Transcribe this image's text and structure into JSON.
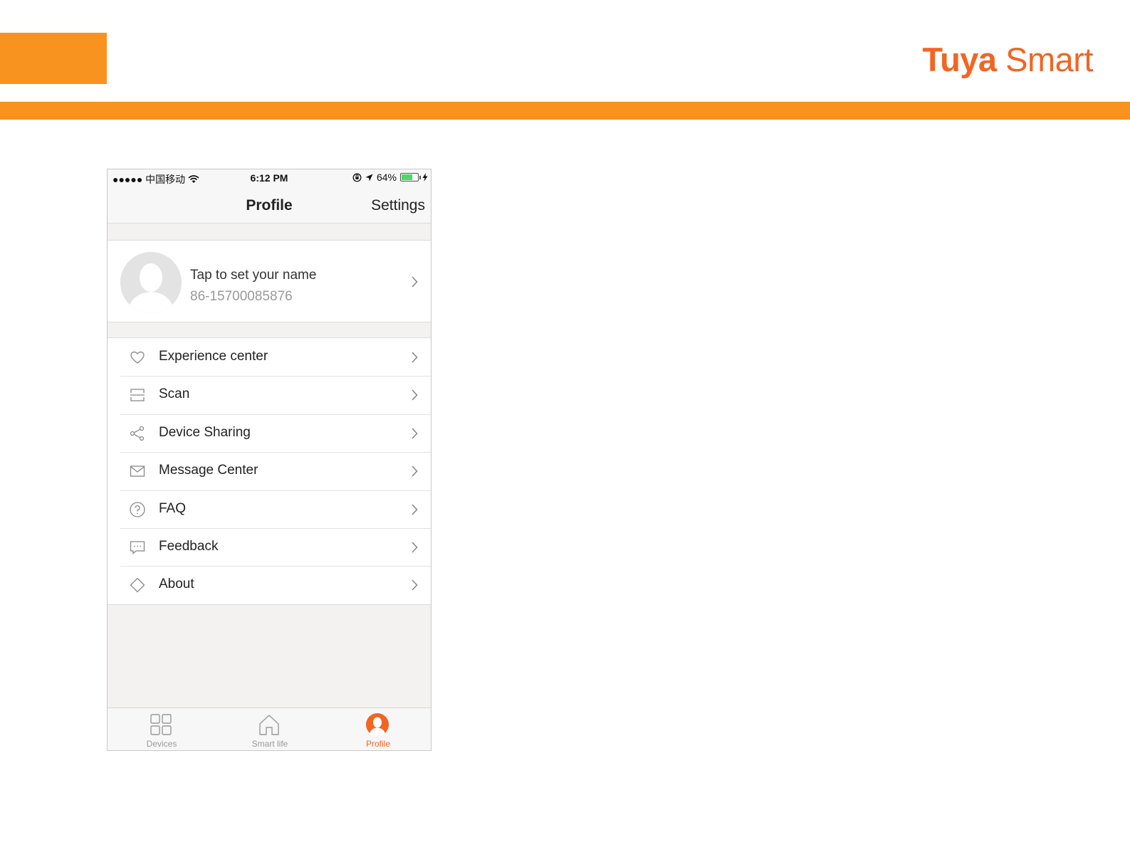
{
  "slide": {
    "brand_primary": "Tuya",
    "brand_secondary": " Smart",
    "accent_color": "#f7931e",
    "brand_color": "#f26522"
  },
  "statusbar": {
    "carrier": "●●●●● 中国移动",
    "time": "6:12 PM",
    "battery": "64%"
  },
  "navbar": {
    "title": "Profile",
    "settings_label": "Settings"
  },
  "profile": {
    "name_prompt": "Tap to set your name",
    "phone": "86-15700085876"
  },
  "menu": {
    "items": [
      {
        "label": "Experience center",
        "icon": "heart-icon"
      },
      {
        "label": "Scan",
        "icon": "scan-icon"
      },
      {
        "label": "Device Sharing",
        "icon": "share-icon"
      },
      {
        "label": "Message Center",
        "icon": "envelope-icon"
      },
      {
        "label": "FAQ",
        "icon": "question-icon"
      },
      {
        "label": "Feedback",
        "icon": "chat-icon"
      },
      {
        "label": "About",
        "icon": "diamond-icon"
      }
    ]
  },
  "tabbar": {
    "tabs": [
      {
        "label": "Devices",
        "icon": "grid-icon",
        "active": false
      },
      {
        "label": "Smart life",
        "icon": "home-icon",
        "active": false
      },
      {
        "label": "Profile",
        "icon": "person-icon",
        "active": true
      }
    ]
  }
}
